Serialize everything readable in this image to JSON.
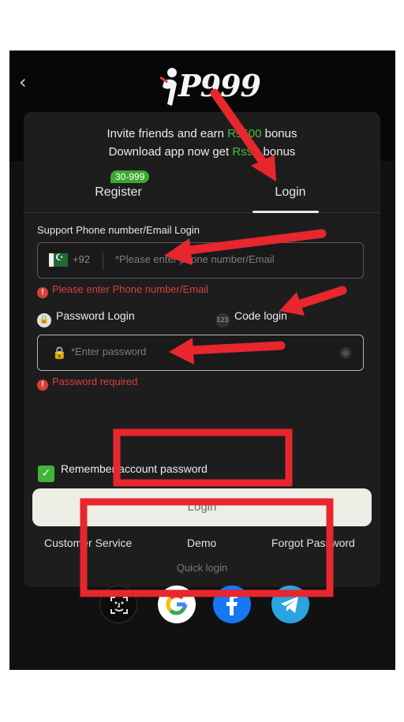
{
  "header": {
    "back_icon": "chevron-left-icon",
    "logo_text": "P999"
  },
  "promo": {
    "line1_prefix": "Invite friends and earn ",
    "line1_amount": "Rs500",
    "line1_suffix": " bonus",
    "line2_prefix": "Download app now get ",
    "line2_amount": "Rs99",
    "line2_suffix": " bonus"
  },
  "tabs": {
    "register": "Register",
    "register_badge": "30-999",
    "login": "Login"
  },
  "phone_field": {
    "label": "Support Phone number/Email Login",
    "country_code": "+92",
    "placeholder": "*Please enter phone number/Email",
    "error": "Please enter Phone number/Email"
  },
  "login_modes": {
    "password": "Password Login",
    "code": "Code login",
    "code_icon_text": "123"
  },
  "password_field": {
    "placeholder": "*Enter password",
    "error": "Password required"
  },
  "remember": "Remember account password",
  "login_button": "Login",
  "links": {
    "customer_service": "Customer Service",
    "demo": "Demo",
    "forgot": "Forgot Password"
  },
  "quick_login": {
    "title": "Quick login",
    "providers": [
      "face-id-icon",
      "google-icon",
      "facebook-icon",
      "telegram-icon"
    ]
  },
  "colors": {
    "accent_green": "#3fc23b",
    "error_red": "#d9403a",
    "annotation_red": "#e8262e",
    "button_bg": "#eeede6"
  }
}
